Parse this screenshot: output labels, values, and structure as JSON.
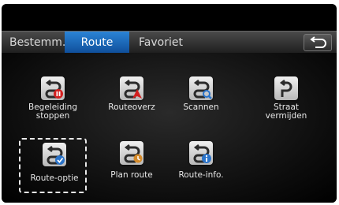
{
  "tabs": [
    {
      "label": "Bestemm."
    },
    {
      "label": "Route",
      "active": true
    },
    {
      "label": "Favoriet"
    }
  ],
  "back_icon": "back-arrow-icon",
  "menu": {
    "items": [
      {
        "label": "Begeleiding\nstoppen",
        "icon": "stop-guidance-icon"
      },
      {
        "label": "Routeoverz",
        "icon": "route-overview-icon"
      },
      {
        "label": "Scannen",
        "icon": "scan-icon"
      },
      {
        "label": "Straat\nvermijden",
        "icon": "avoid-street-icon"
      },
      {
        "label": "Route-optie",
        "icon": "route-option-icon",
        "selected": true
      },
      {
        "label": "Plan route",
        "icon": "plan-route-icon"
      },
      {
        "label": "Route-info.",
        "icon": "route-info-icon"
      }
    ]
  },
  "colors": {
    "tab_active": "#1a6bc0",
    "background": "#000000",
    "text": "#e8e8e8",
    "badge_red": "#d32020",
    "badge_blue": "#2a73c9",
    "badge_orange": "#d48a2a"
  }
}
